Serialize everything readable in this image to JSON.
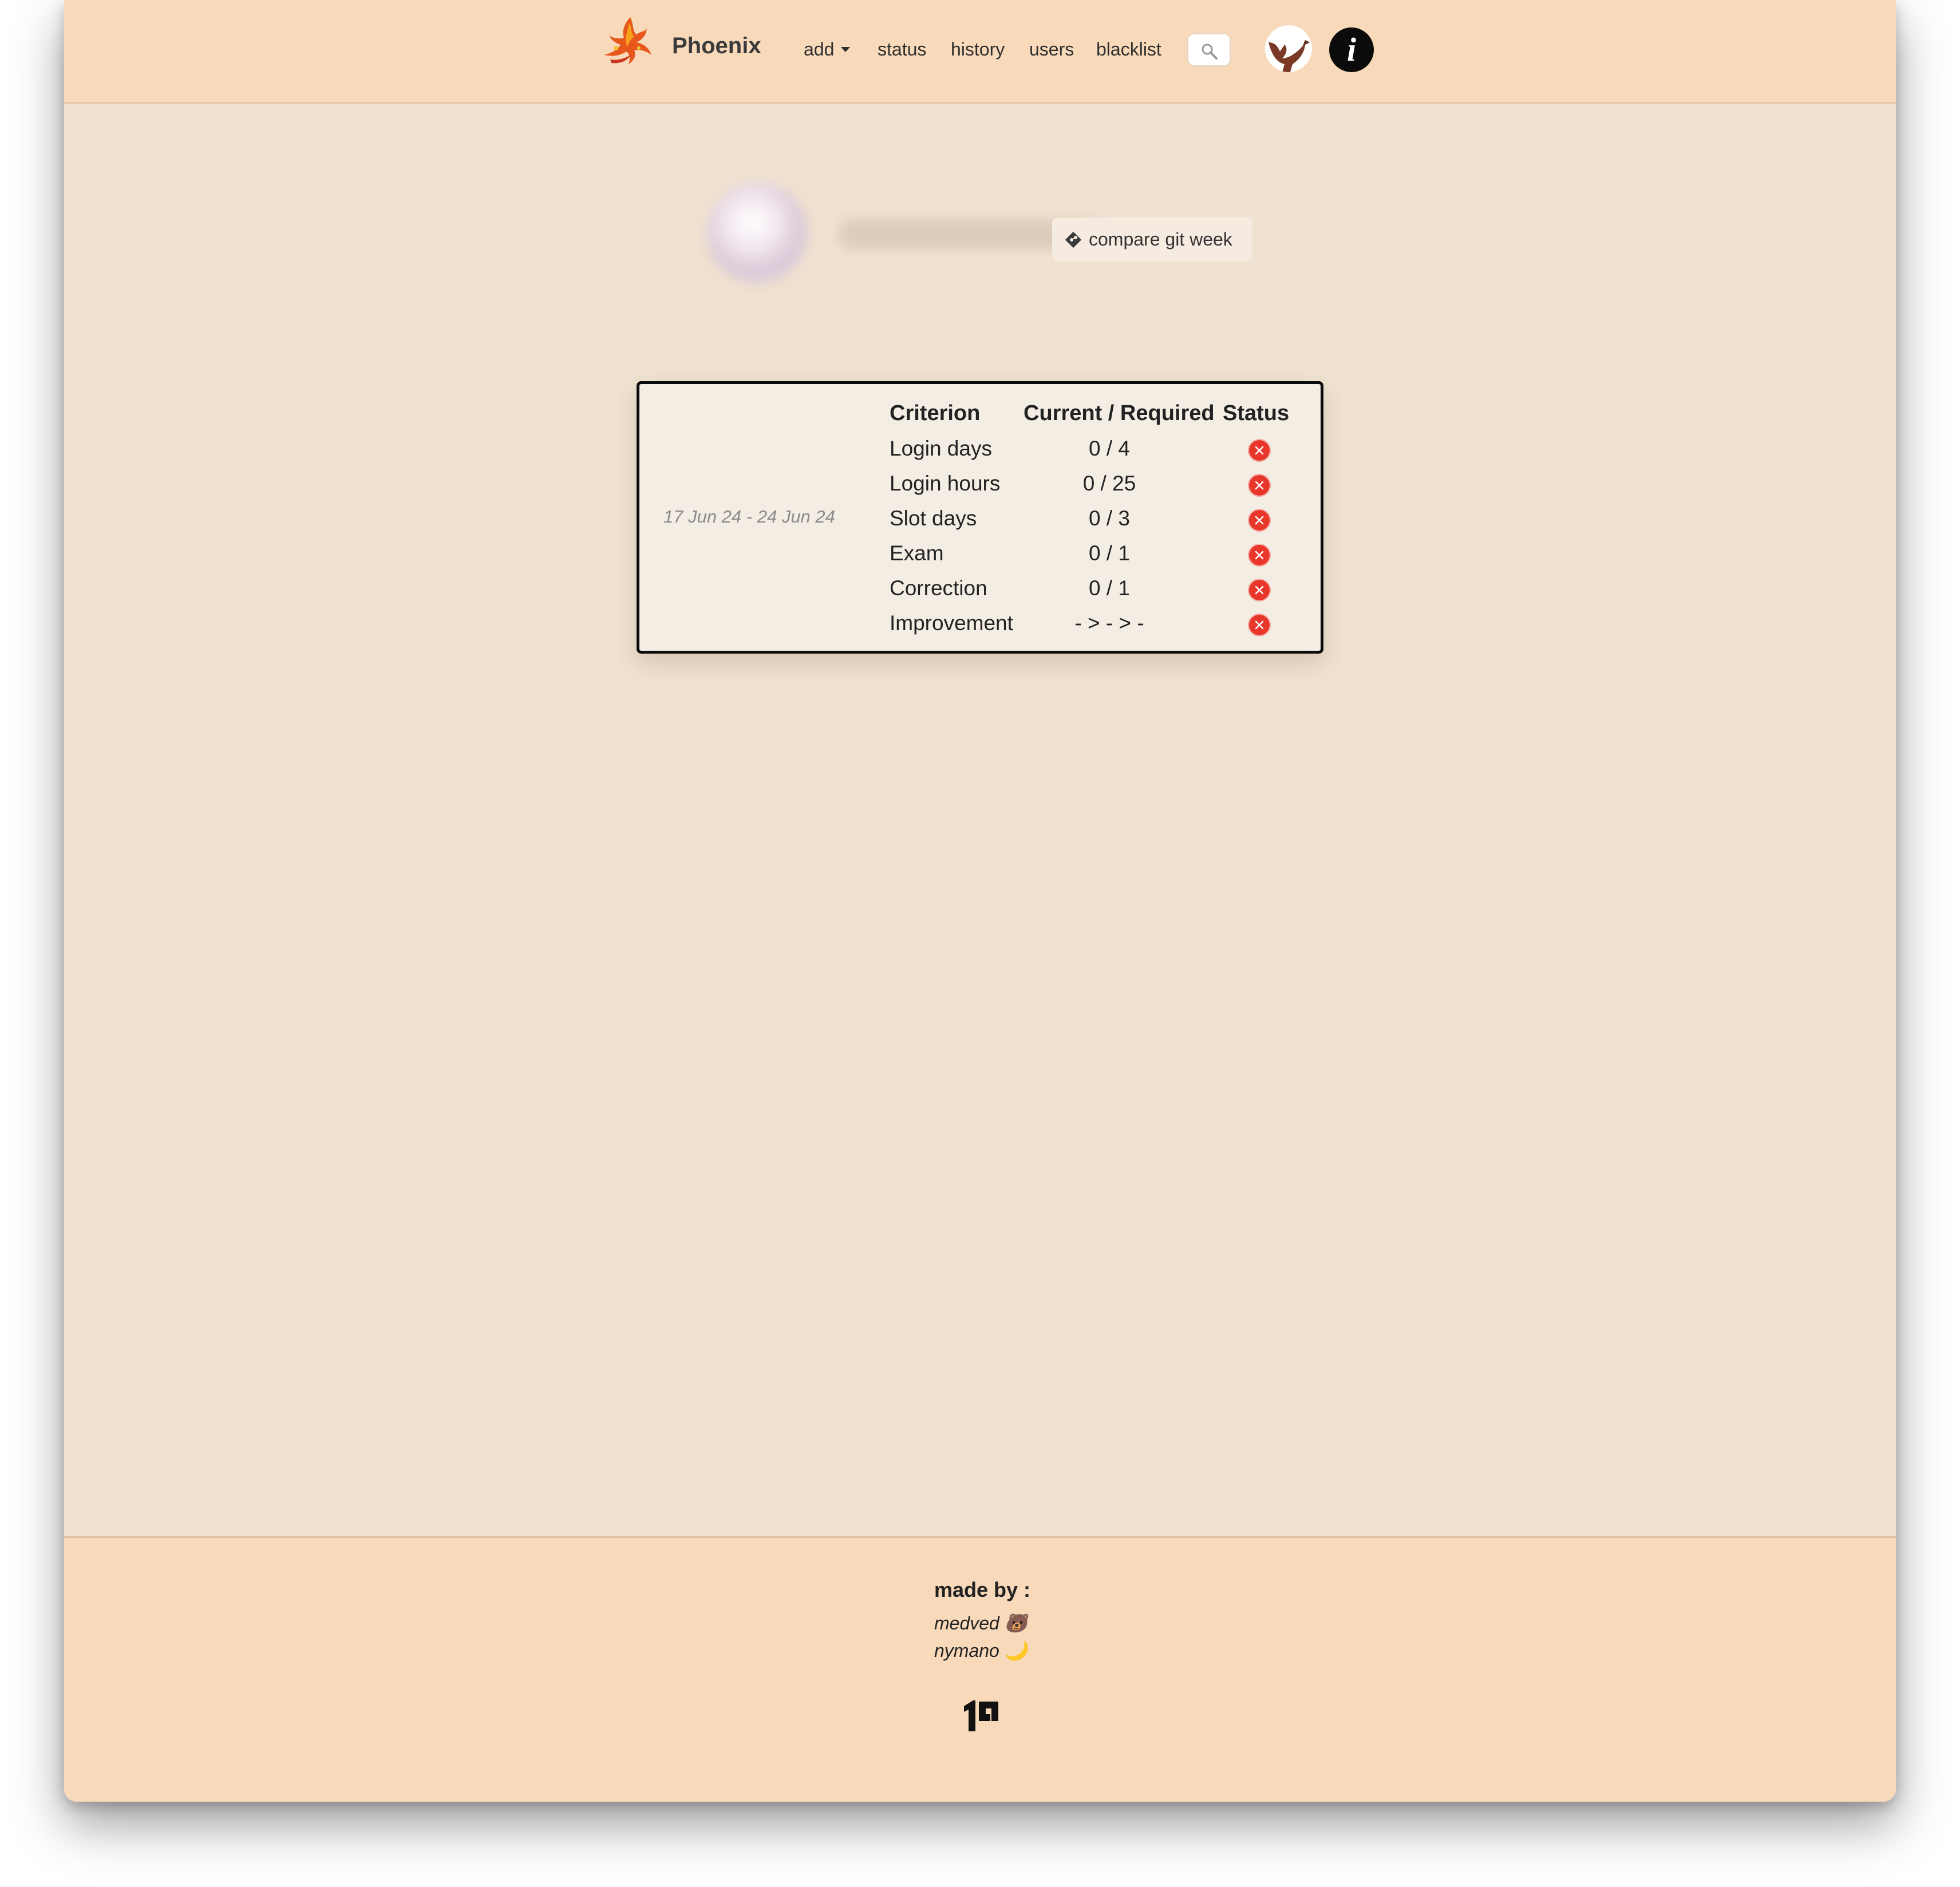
{
  "navbar": {
    "brand": "Phoenix",
    "items": [
      {
        "label": "add",
        "has_dropdown": true
      },
      {
        "label": "status"
      },
      {
        "label": "history"
      },
      {
        "label": "users"
      },
      {
        "label": "blacklist"
      }
    ],
    "icons": [
      "phoenix-logo-icon",
      "search-icon",
      "user-avatar-icon",
      "info-icon"
    ]
  },
  "profile": {
    "name": "",
    "compare_button": "compare git week",
    "compare_icon": "git-icon"
  },
  "week_card": {
    "range": "17 Jun 24 - 24 Jun 24",
    "headers": {
      "criterion": "Criterion",
      "current_required": "Current / Required",
      "status": "Status"
    },
    "rows": [
      {
        "criterion": "Login days",
        "value": "0 / 4",
        "status": "fail"
      },
      {
        "criterion": "Login hours",
        "value": "0 / 25",
        "status": "fail"
      },
      {
        "criterion": "Slot days",
        "value": "0 / 3",
        "status": "fail"
      },
      {
        "criterion": "Exam",
        "value": "0 / 1",
        "status": "fail"
      },
      {
        "criterion": "Correction",
        "value": "0 / 1",
        "status": "fail"
      },
      {
        "criterion": "Improvement",
        "value": "- > - > -",
        "status": "fail"
      }
    ]
  },
  "footer": {
    "made_by": "made by :",
    "authors": [
      "medved 🐻",
      "nymano 🌙"
    ],
    "logo": "19-logo-icon"
  },
  "colors": {
    "navbar_bg": "#f8d9b9",
    "page_bg": "#f0e2d0",
    "card_bg": "#f3ede4",
    "status_fail": "#e8362b"
  }
}
